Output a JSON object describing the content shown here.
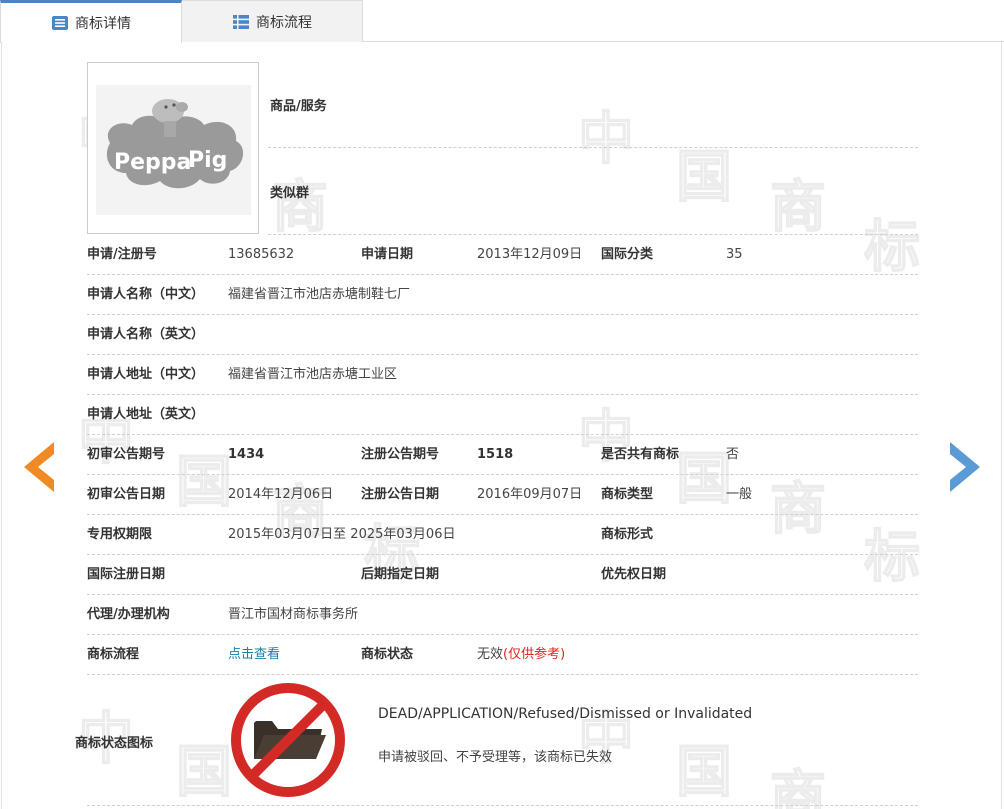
{
  "tabs": {
    "detail_label": "商标详情",
    "flow_label": "商标流程",
    "active": "detail"
  },
  "product_service": {
    "goods_label": "商品/服务",
    "similar_group_label": "类似群"
  },
  "trademark_image_alt": "Peppa Pig",
  "details": {
    "reg_no_label": "申请/注册号",
    "reg_no": "13685632",
    "app_date_label": "申请日期",
    "app_date": "2013年12月09日",
    "intl_class_label": "国际分类",
    "intl_class": "35",
    "applicant_cn_label": "申请人名称（中文）",
    "applicant_cn": "福建省晋江市池店赤塘制鞋七厂",
    "applicant_en_label": "申请人名称（英文）",
    "applicant_en": "",
    "address_cn_label": "申请人地址（中文）",
    "address_cn": "福建省晋江市池店赤塘工业区",
    "address_en_label": "申请人地址（英文）",
    "address_en": "",
    "prelim_pub_no_label": "初审公告期号",
    "prelim_pub_no": "1434",
    "reg_pub_no_label": "注册公告期号",
    "reg_pub_no": "1518",
    "shared_label": "是否共有商标",
    "shared": "否",
    "prelim_pub_date_label": "初审公告日期",
    "prelim_pub_date": "2014年12月06日",
    "reg_pub_date_label": "注册公告日期",
    "reg_pub_date": "2016年09月07日",
    "tm_type_label": "商标类型",
    "tm_type": "一般",
    "exclusive_period_label": "专用权期限",
    "exclusive_period": "2015年03月07日至 2025年03月06日",
    "tm_form_label": "商标形式",
    "tm_form": "",
    "intl_reg_date_label": "国际注册日期",
    "intl_reg_date": "",
    "later_designation_date_label": "后期指定日期",
    "later_designation_date": "",
    "priority_date_label": "优先权日期",
    "priority_date": "",
    "agent_label": "代理/办理机构",
    "agent": "晋江市国材商标事务所",
    "flow_label": "商标流程",
    "flow_link": "点击查看",
    "status_label": "商标状态",
    "status_value": "无效",
    "status_note": "(仅供参考)"
  },
  "status_icon": {
    "label": "商标状态图标",
    "english": "DEAD/APPLICATION/Refused/Dismissed or Invalidated",
    "chinese": "申请被驳回、不予受理等，该商标已失效",
    "icon": "folder-prohibited-icon"
  },
  "watermark_chars": [
    "中",
    "国",
    "商",
    "标"
  ],
  "colors": {
    "tab_accent": "#4a86c5",
    "prev_arrow": "#f08a24",
    "next_arrow": "#5b9bd5",
    "link": "#1a7fa7",
    "note_red": "#e0251b",
    "prohibit_red": "#d42a26"
  }
}
